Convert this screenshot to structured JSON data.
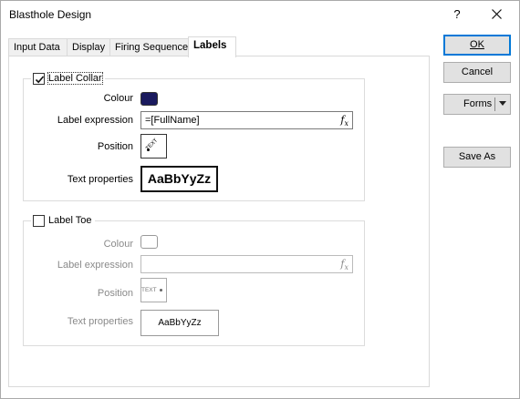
{
  "window": {
    "title": "Blasthole Design",
    "help_label": "?"
  },
  "tabs": [
    {
      "label": "Input Data"
    },
    {
      "label": "Display"
    },
    {
      "label": "Firing Sequence"
    },
    {
      "label": "Labels"
    }
  ],
  "label_collar": {
    "checkbox_label": "Label Collar",
    "checked": true,
    "colour_label": "Colour",
    "colour_value": "#1a1a5e",
    "expression_label": "Label expression",
    "expression_value": "=[FullName]",
    "position_label": "Position",
    "position_preview": "TEXT",
    "text_properties_label": "Text properties",
    "text_sample": "AaBbYyZz"
  },
  "label_toe": {
    "checkbox_label": "Label Toe",
    "checked": false,
    "colour_label": "Colour",
    "colour_value": "#ffffff",
    "expression_label": "Label expression",
    "expression_value": "",
    "position_label": "Position",
    "position_preview": "TEXT",
    "text_properties_label": "Text properties",
    "text_sample": "AaBbYyZz"
  },
  "buttons": {
    "ok": "OK",
    "cancel": "Cancel",
    "forms": "Forms",
    "save_as": "Save As"
  },
  "icons": {
    "close": "close-icon",
    "fx": "fx-icon",
    "dropdown": "chevron-down-icon"
  }
}
